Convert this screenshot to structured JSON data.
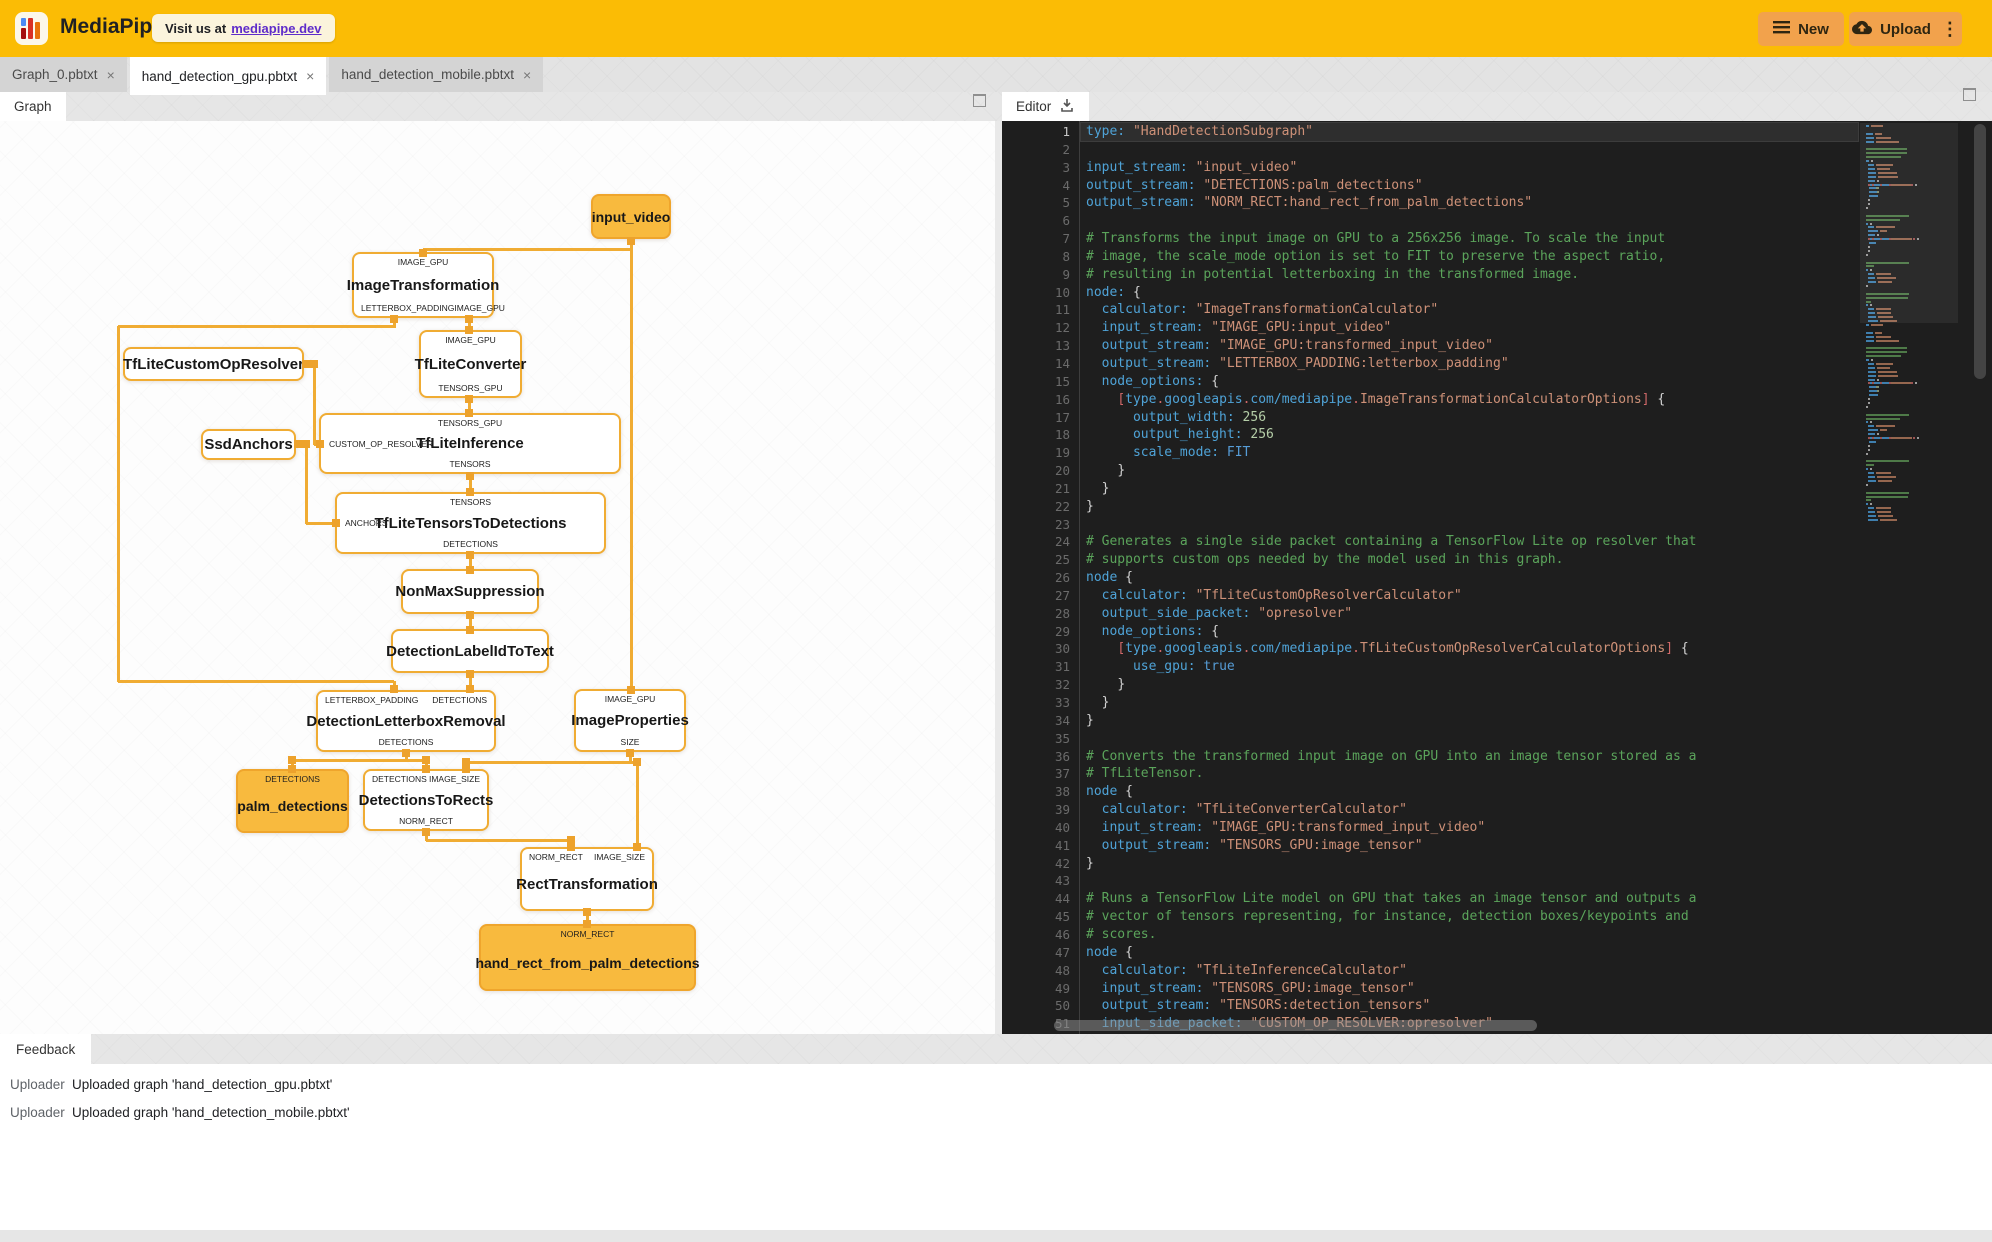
{
  "header": {
    "app_title": "MediaPipe",
    "visit_prefix": "Visit us at",
    "visit_link": "mediapipe.dev",
    "new_label": "New",
    "upload_label": "Upload"
  },
  "icons": {
    "close_glyph": "×",
    "kebab_glyph": "⋮"
  },
  "doc_tabs": [
    {
      "label": "Graph_0.pbtxt"
    },
    {
      "label": "hand_detection_gpu.pbtxt"
    },
    {
      "label": "hand_detection_mobile.pbtxt"
    }
  ],
  "panels": {
    "graph_tab": "Graph",
    "editor_tab": "Editor",
    "feedback_tab": "Feedback"
  },
  "graph": {
    "nodes": {
      "input_video": {
        "title": "input_video"
      },
      "image_transformation": {
        "title": "ImageTransformation",
        "top": [
          "IMAGE_GPU"
        ],
        "bottom": [
          "LETTERBOX_PADDING",
          "IMAGE_GPU"
        ]
      },
      "tflite_converter": {
        "title": "TfLiteConverter",
        "top": [
          "IMAGE_GPU"
        ],
        "bottom": [
          "TENSORS_GPU"
        ]
      },
      "tflite_custom_op_resolver": {
        "title": "TfLiteCustomOpResolver"
      },
      "ssd_anchors": {
        "title": "SsdAnchors"
      },
      "tflite_inference": {
        "title": "TfLiteInference",
        "top": [
          "TENSORS_GPU"
        ],
        "left": "CUSTOM_OP_RESOLVER",
        "bottom": [
          "TENSORS"
        ]
      },
      "tflite_tensors_to_detections": {
        "title": "TfLiteTensorsToDetections",
        "top": [
          "TENSORS"
        ],
        "left": "ANCHORS",
        "bottom": [
          "DETECTIONS"
        ]
      },
      "non_max_suppression": {
        "title": "NonMaxSuppression"
      },
      "detection_label_id_to_text": {
        "title": "DetectionLabelIdToText"
      },
      "detection_letterbox_removal": {
        "title": "DetectionLetterboxRemoval",
        "top": [
          "LETTERBOX_PADDING",
          "DETECTIONS"
        ],
        "bottom": [
          "DETECTIONS"
        ]
      },
      "image_properties": {
        "title": "ImageProperties",
        "top": [
          "IMAGE_GPU"
        ],
        "bottom": [
          "SIZE"
        ]
      },
      "palm_detections": {
        "title": "palm_detections",
        "top": [
          "DETECTIONS"
        ]
      },
      "detections_to_rects": {
        "title": "DetectionsToRects",
        "top": [
          "DETECTIONS",
          "IMAGE_SIZE"
        ],
        "bottom": [
          "NORM_RECT"
        ]
      },
      "rect_transformation": {
        "title": "RectTransformation",
        "top": [
          "NORM_RECT",
          "IMAGE_SIZE"
        ]
      },
      "hand_rect_from_palm_detections": {
        "title": "hand_rect_from_palm_detections",
        "top": [
          "NORM_RECT"
        ]
      }
    }
  },
  "editor": {
    "lines": [
      [
        [
          "k",
          "type:"
        ],
        [
          "d",
          " "
        ],
        [
          "s",
          "\"HandDetectionSubgraph\""
        ]
      ],
      [],
      [
        [
          "k",
          "input_stream:"
        ],
        [
          "d",
          " "
        ],
        [
          "s",
          "\"input_video\""
        ]
      ],
      [
        [
          "k",
          "output_stream:"
        ],
        [
          "d",
          " "
        ],
        [
          "s",
          "\"DETECTIONS:palm_detections\""
        ]
      ],
      [
        [
          "k",
          "output_stream:"
        ],
        [
          "d",
          " "
        ],
        [
          "s",
          "\"NORM_RECT:hand_rect_from_palm_detections\""
        ]
      ],
      [],
      [
        [
          "c",
          "# Transforms the input image on GPU to a 256x256 image. To scale the input"
        ]
      ],
      [
        [
          "c",
          "# image, the scale_mode option is set to FIT to preserve the aspect ratio,"
        ]
      ],
      [
        [
          "c",
          "# resulting in potential letterboxing in the transformed image."
        ]
      ],
      [
        [
          "k",
          "node:"
        ],
        [
          "d",
          " "
        ],
        [
          "p",
          "{"
        ]
      ],
      [
        [
          "d",
          "  "
        ],
        [
          "k",
          "calculator:"
        ],
        [
          "d",
          " "
        ],
        [
          "s",
          "\"ImageTransformationCalculator\""
        ]
      ],
      [
        [
          "d",
          "  "
        ],
        [
          "k",
          "input_stream:"
        ],
        [
          "d",
          " "
        ],
        [
          "s",
          "\"IMAGE_GPU:input_video\""
        ]
      ],
      [
        [
          "d",
          "  "
        ],
        [
          "k",
          "output_stream:"
        ],
        [
          "d",
          " "
        ],
        [
          "s",
          "\"IMAGE_GPU:transformed_input_video\""
        ]
      ],
      [
        [
          "d",
          "  "
        ],
        [
          "k",
          "output_stream:"
        ],
        [
          "d",
          " "
        ],
        [
          "s",
          "\"LETTERBOX_PADDING:letterbox_padding\""
        ]
      ],
      [
        [
          "d",
          "  "
        ],
        [
          "k",
          "node_options:"
        ],
        [
          "d",
          " "
        ],
        [
          "p",
          "{"
        ]
      ],
      [
        [
          "d",
          "    "
        ],
        [
          "r",
          "["
        ],
        [
          "k",
          "type"
        ],
        [
          "r",
          "."
        ],
        [
          "k",
          "googleapis"
        ],
        [
          "r",
          "."
        ],
        [
          "k",
          "com/mediapipe"
        ],
        [
          "r",
          "."
        ],
        [
          "s",
          "ImageTransformationCalculatorOptions"
        ],
        [
          "r",
          "]"
        ],
        [
          "d",
          " "
        ],
        [
          "p",
          "{"
        ]
      ],
      [
        [
          "d",
          "      "
        ],
        [
          "k",
          "output_width:"
        ],
        [
          "n",
          " 256"
        ]
      ],
      [
        [
          "d",
          "      "
        ],
        [
          "k",
          "output_height:"
        ],
        [
          "n",
          " 256"
        ]
      ],
      [
        [
          "d",
          "      "
        ],
        [
          "k",
          "scale_mode:"
        ],
        [
          "e",
          " FIT"
        ]
      ],
      [
        [
          "d",
          "    "
        ],
        [
          "p",
          "}"
        ]
      ],
      [
        [
          "d",
          "  "
        ],
        [
          "p",
          "}"
        ]
      ],
      [
        [
          "p",
          "}"
        ]
      ],
      [],
      [
        [
          "c",
          "# Generates a single side packet containing a TensorFlow Lite op resolver that"
        ]
      ],
      [
        [
          "c",
          "# supports custom ops needed by the model used in this graph."
        ]
      ],
      [
        [
          "k",
          "node"
        ],
        [
          "d",
          " "
        ],
        [
          "p",
          "{"
        ]
      ],
      [
        [
          "d",
          "  "
        ],
        [
          "k",
          "calculator:"
        ],
        [
          "d",
          " "
        ],
        [
          "s",
          "\"TfLiteCustomOpResolverCalculator\""
        ]
      ],
      [
        [
          "d",
          "  "
        ],
        [
          "k",
          "output_side_packet:"
        ],
        [
          "d",
          " "
        ],
        [
          "s",
          "\"opresolver\""
        ]
      ],
      [
        [
          "d",
          "  "
        ],
        [
          "k",
          "node_options:"
        ],
        [
          "d",
          " "
        ],
        [
          "p",
          "{"
        ]
      ],
      [
        [
          "d",
          "    "
        ],
        [
          "r",
          "["
        ],
        [
          "k",
          "type"
        ],
        [
          "r",
          "."
        ],
        [
          "k",
          "googleapis"
        ],
        [
          "r",
          "."
        ],
        [
          "k",
          "com/mediapipe"
        ],
        [
          "r",
          "."
        ],
        [
          "s",
          "TfLiteCustomOpResolverCalculatorOptions"
        ],
        [
          "r",
          "]"
        ],
        [
          "d",
          " "
        ],
        [
          "p",
          "{"
        ]
      ],
      [
        [
          "d",
          "      "
        ],
        [
          "k",
          "use_gpu:"
        ],
        [
          "e",
          " true"
        ]
      ],
      [
        [
          "d",
          "    "
        ],
        [
          "p",
          "}"
        ]
      ],
      [
        [
          "d",
          "  "
        ],
        [
          "p",
          "}"
        ]
      ],
      [
        [
          "p",
          "}"
        ]
      ],
      [],
      [
        [
          "c",
          "# Converts the transformed input image on GPU into an image tensor stored as a"
        ]
      ],
      [
        [
          "c",
          "# TfLiteTensor."
        ]
      ],
      [
        [
          "k",
          "node"
        ],
        [
          "d",
          " "
        ],
        [
          "p",
          "{"
        ]
      ],
      [
        [
          "d",
          "  "
        ],
        [
          "k",
          "calculator:"
        ],
        [
          "d",
          " "
        ],
        [
          "s",
          "\"TfLiteConverterCalculator\""
        ]
      ],
      [
        [
          "d",
          "  "
        ],
        [
          "k",
          "input_stream:"
        ],
        [
          "d",
          " "
        ],
        [
          "s",
          "\"IMAGE_GPU:transformed_input_video\""
        ]
      ],
      [
        [
          "d",
          "  "
        ],
        [
          "k",
          "output_stream:"
        ],
        [
          "d",
          " "
        ],
        [
          "s",
          "\"TENSORS_GPU:image_tensor\""
        ]
      ],
      [
        [
          "p",
          "}"
        ]
      ],
      [],
      [
        [
          "c",
          "# Runs a TensorFlow Lite model on GPU that takes an image tensor and outputs a"
        ]
      ],
      [
        [
          "c",
          "# vector of tensors representing, for instance, detection boxes/keypoints and"
        ]
      ],
      [
        [
          "c",
          "# scores."
        ]
      ],
      [
        [
          "k",
          "node"
        ],
        [
          "d",
          " "
        ],
        [
          "p",
          "{"
        ]
      ],
      [
        [
          "d",
          "  "
        ],
        [
          "k",
          "calculator:"
        ],
        [
          "d",
          " "
        ],
        [
          "s",
          "\"TfLiteInferenceCalculator\""
        ]
      ],
      [
        [
          "d",
          "  "
        ],
        [
          "k",
          "input_stream:"
        ],
        [
          "d",
          " "
        ],
        [
          "s",
          "\"TENSORS_GPU:image_tensor\""
        ]
      ],
      [
        [
          "d",
          "  "
        ],
        [
          "k",
          "output_stream:"
        ],
        [
          "d",
          " "
        ],
        [
          "s",
          "\"TENSORS:detection_tensors\""
        ]
      ],
      [
        [
          "d",
          "  "
        ],
        [
          "k",
          "input_side_packet:"
        ],
        [
          "d",
          " "
        ],
        [
          "s",
          "\"CUSTOM_OP_RESOLVER:opresolver\""
        ]
      ]
    ]
  },
  "feedback": {
    "rows": [
      {
        "source": "Uploader",
        "message": "Uploaded graph 'hand_detection_gpu.pbtxt'"
      },
      {
        "source": "Uploader",
        "message": "Uploaded graph 'hand_detection_mobile.pbtxt'"
      }
    ]
  },
  "colors": {
    "header_bg": "#FBBC05",
    "button_bg": "#F2A24C",
    "node_border": "#F0AC33",
    "node_fill": "#F8BA3E",
    "edge": "#F0AC33",
    "editor_bg": "#1E1E1E",
    "code_key": "#4FA3D7",
    "code_string": "#CE9178",
    "code_comment": "#5BA45B",
    "code_number": "#B5CEA8",
    "link_purple": "#5E2CCA"
  }
}
